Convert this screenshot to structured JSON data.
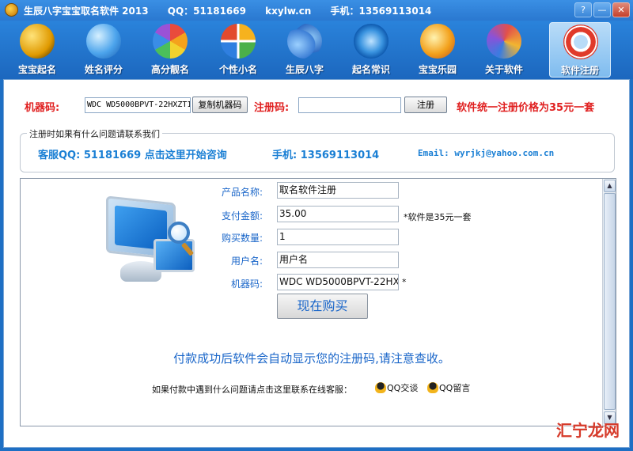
{
  "window": {
    "title_parts": [
      "生辰八字宝宝取名软件 2013",
      "QQ：51181669",
      "kxylw.cn",
      "手机：13569113014"
    ],
    "controls": [
      "?",
      "—",
      "✕"
    ]
  },
  "toolbar": {
    "items": [
      {
        "label": "宝宝起名",
        "icon": "taiji-icon"
      },
      {
        "label": "姓名评分",
        "icon": "globe-icon"
      },
      {
        "label": "高分靓名",
        "icon": "hexagon-icon"
      },
      {
        "label": "个性小名",
        "icon": "windows-icon"
      },
      {
        "label": "生辰八字",
        "icon": "flower-icon"
      },
      {
        "label": "起名常识",
        "icon": "swirl-icon"
      },
      {
        "label": "宝宝乐园",
        "icon": "fish-icon"
      },
      {
        "label": "关于软件",
        "icon": "butterfly-icon"
      },
      {
        "label": "软件注册",
        "icon": "lifebuoy-icon",
        "active": true
      }
    ]
  },
  "registration": {
    "machine_code_label": "机器码:",
    "machine_code_value": "WDC WD5000BPVT-22HXZT1",
    "copy_button": "复制机器码",
    "reg_code_label": "注册码:",
    "reg_code_value": "",
    "register_button": "注册",
    "price_text": "软件统一注册价格为35元一套"
  },
  "contact": {
    "legend": "注册时如果有什么问题请联系我们",
    "qq_text": "客服QQ: 51181669 点击这里开始咨询",
    "phone_text": "手机: 13569113014",
    "email_text": "Email: wyrjkj@yahoo.com.cn"
  },
  "purchase": {
    "product_label": "产品名称:",
    "product_value": "取名软件注册",
    "amount_label": "支付金额:",
    "amount_value": "35.00",
    "amount_note": "*软件是35元一套",
    "qty_label": "购买数量:",
    "qty_value": "1",
    "user_label": "用户名:",
    "user_value": "用户名",
    "machine_label": "机器码:",
    "machine_value": "WDC WD5000BPVT-22HX",
    "machine_note": "*",
    "buy_button": "现在购买",
    "notice": "付款成功后软件会自动显示您的注册码,请注意查收。",
    "help_text": "如果付款中遇到什么问题请点击这里联系在线客服：",
    "qq_chat": "QQ交谈",
    "qq_message": "QQ留言"
  },
  "watermark": "汇宁龙网",
  "colors": {
    "accent": "#1e6fc4",
    "red": "#e02020",
    "link_blue": "#1a7fd4"
  }
}
